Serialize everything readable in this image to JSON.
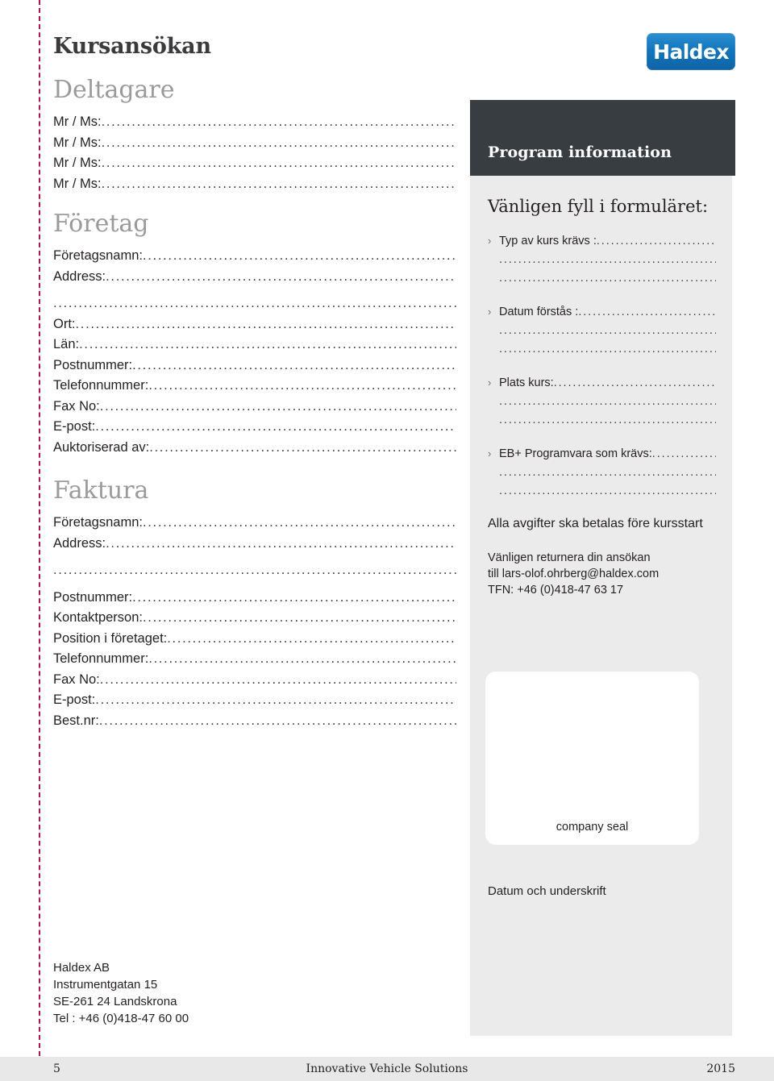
{
  "document": {
    "title": "Kursansökan"
  },
  "brand": {
    "logo_text": "Haldex",
    "logo_color": "#1275bb"
  },
  "left": {
    "sections": [
      {
        "heading": "Deltagare",
        "fields": [
          {
            "label": "Mr / Ms:",
            "dotted": true
          },
          {
            "label": "Mr / Ms:",
            "dotted": true
          },
          {
            "label": "Mr / Ms:",
            "dotted": true
          },
          {
            "label": "Mr / Ms:",
            "dotted": true
          }
        ]
      },
      {
        "heading": "Företag",
        "fields": [
          {
            "label": "Företagsnamn:",
            "dotted": true
          },
          {
            "label": "Address:",
            "dotted": true
          },
          {
            "label": "",
            "dotted": true
          },
          {
            "label": "Ort:",
            "dotted": true
          },
          {
            "label": "Län:",
            "dotted": true
          },
          {
            "label": "Postnummer:",
            "dotted": true
          },
          {
            "label": "Telefonnummer:",
            "dotted": true
          },
          {
            "label": "Fax No:",
            "dotted": true
          },
          {
            "label": "E-post:",
            "dotted": true
          },
          {
            "label": "Auktoriserad av:",
            "dotted": true
          }
        ]
      },
      {
        "heading": "Faktura",
        "fields": [
          {
            "label": "Företagsnamn:",
            "dotted": true
          },
          {
            "label": "Address:",
            "dotted": true
          },
          {
            "label": "",
            "dotted": true
          },
          {
            "label": "Postnummer:",
            "dotted": true
          },
          {
            "label": "Kontaktperson:",
            "dotted": true
          },
          {
            "label": "Position i företaget:",
            "dotted": true
          },
          {
            "label": "Telefonnummer:",
            "dotted": true
          },
          {
            "label": "Fax No:",
            "dotted": true
          },
          {
            "label": "E-post:",
            "dotted": true
          },
          {
            "label": "Best.nr:",
            "dotted": true
          }
        ]
      }
    ],
    "address_block": [
      "Haldex AB",
      "Instrumentgatan 15",
      "SE-261 24 Landskrona",
      "Tel : +46 (0)418-47 60 00"
    ]
  },
  "right": {
    "header_title": "Program information",
    "lead": "Vänligen fyll i formuläret:",
    "bullets": [
      {
        "label": "Typ av kurs krävs :",
        "extra_lines": 2
      },
      {
        "label": "Datum förstås :",
        "extra_lines": 2
      },
      {
        "label": "Plats kurs:",
        "extra_lines": 2
      },
      {
        "label": "EB+ Programvara som krävs:",
        "extra_lines": 2
      }
    ],
    "note": "Alla avgifter ska betalas före kursstart",
    "contact": [
      "Vänligen returnera din ansökan",
      "till lars-olof.ohrberg@haldex.com",
      "TFN: +46 (0)418-47 63 17"
    ],
    "seal_label": "company seal",
    "signature_label": "Datum och underskrift"
  },
  "footer": {
    "page_number": "5",
    "center_text": "Innovative Vehicle Solutions",
    "year": "2015"
  }
}
